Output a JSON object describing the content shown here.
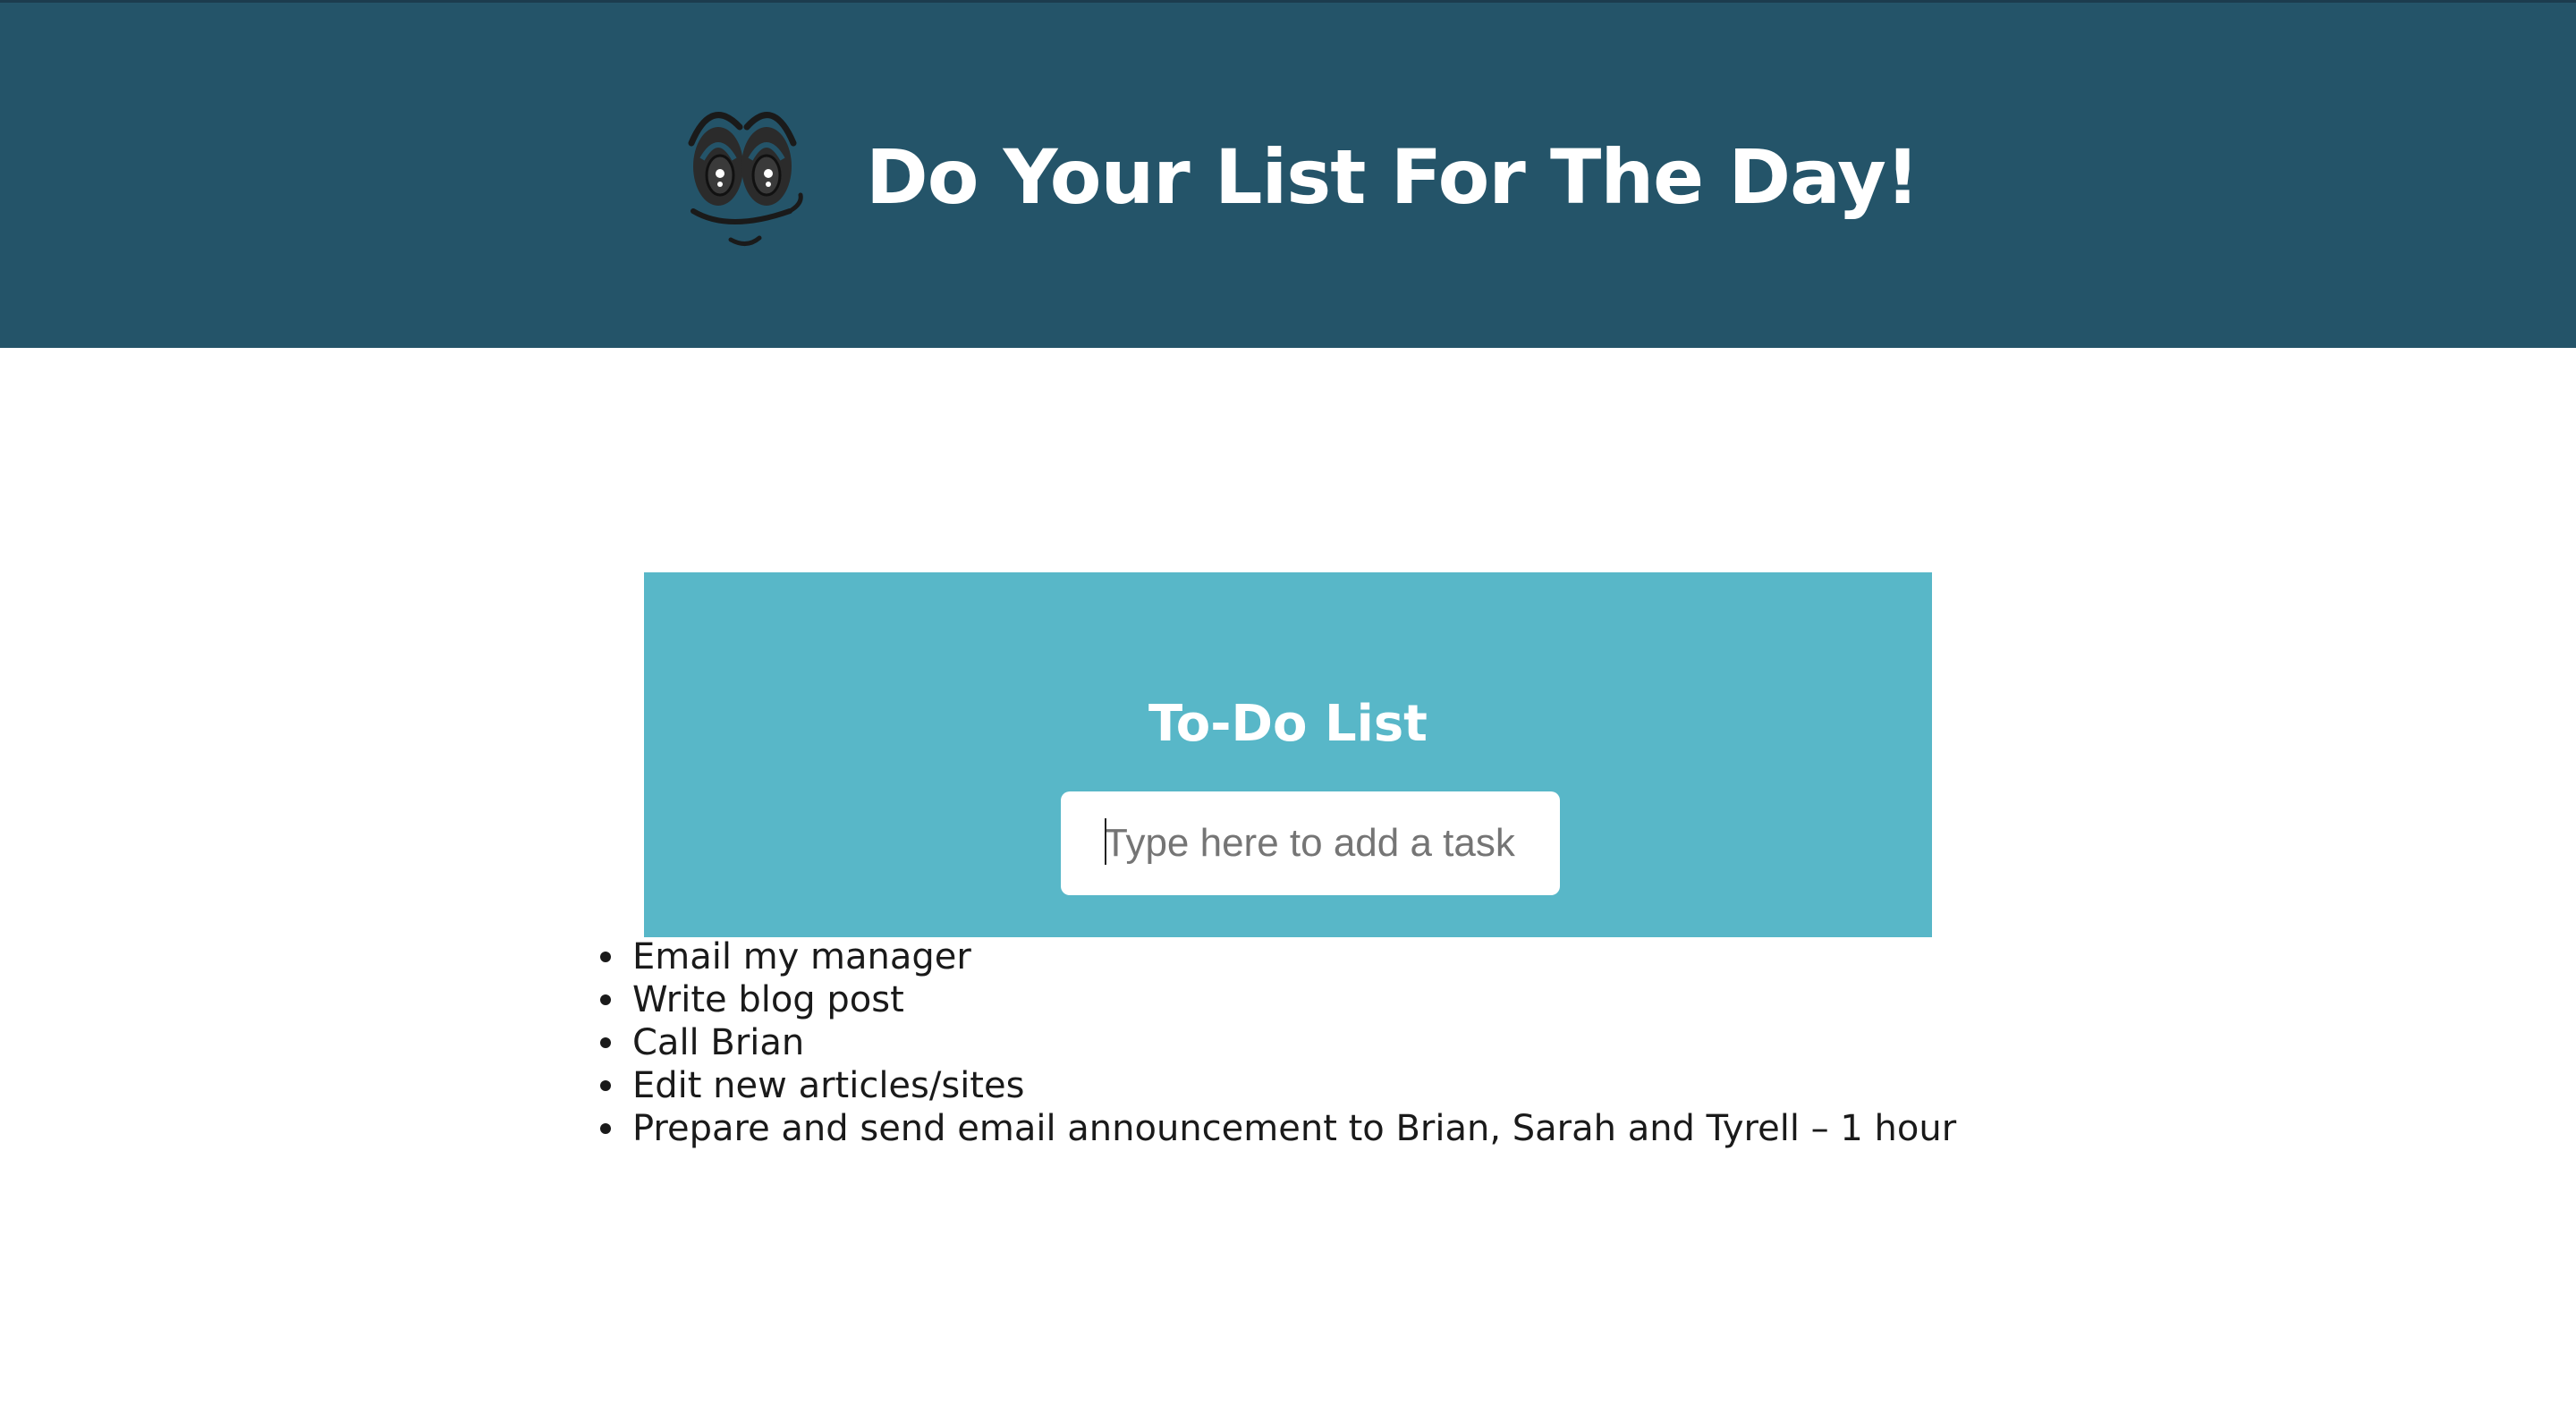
{
  "colors": {
    "header_bg": "#245469",
    "card_bg": "#58b7c8",
    "title_text": "#ffffff"
  },
  "header": {
    "title": "Do Your List For The Day!",
    "logo_icon": "smiley-face-icon"
  },
  "todo": {
    "title": "To-Do List",
    "input_placeholder": "Type here to add a task",
    "input_value": ""
  },
  "tasks": [
    {
      "text": "Email my manager"
    },
    {
      "text": "Write blog post"
    },
    {
      "text": "Call Brian"
    },
    {
      "text": "Edit new articles/sites"
    },
    {
      "text": "Prepare and send email announcement to Brian, Sarah and Tyrell – 1 hour"
    }
  ]
}
